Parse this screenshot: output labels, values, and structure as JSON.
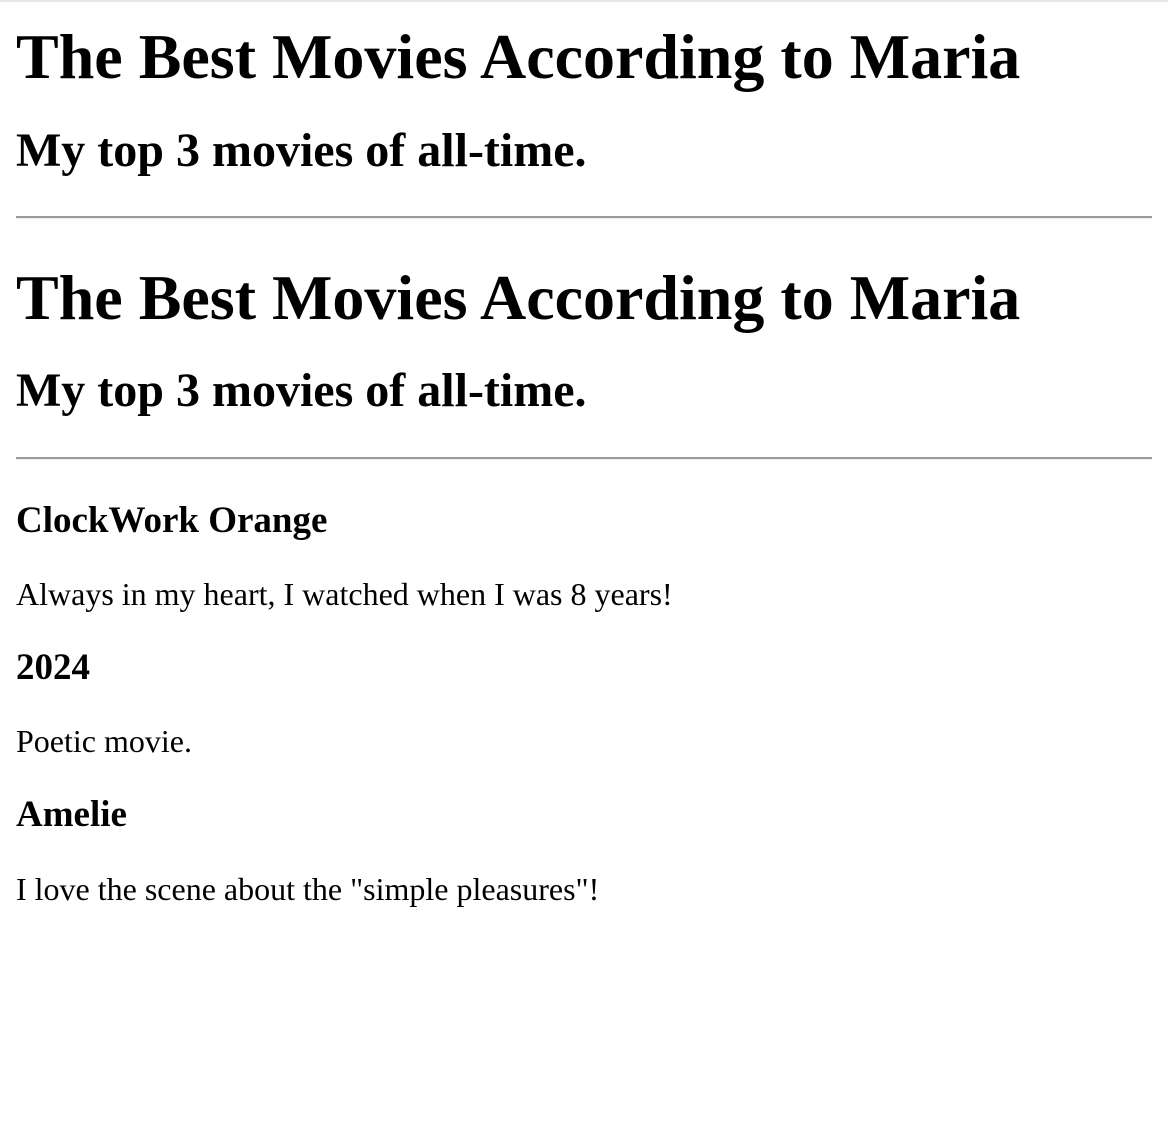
{
  "header": {
    "title": "The Best Movies According to Maria",
    "subtitle": "My top 3 movies of all-time."
  },
  "repeat_header": {
    "title": "The Best Movies According to Maria",
    "subtitle": "My top 3 movies of all-time."
  },
  "movies": [
    {
      "title": "ClockWork Orange",
      "description": "Always in my heart, I watched when I was 8 years!"
    },
    {
      "title": "2024",
      "description": "Poetic movie."
    },
    {
      "title": "Amelie",
      "description": "I love the scene about the \"simple pleasures\"!"
    }
  ]
}
